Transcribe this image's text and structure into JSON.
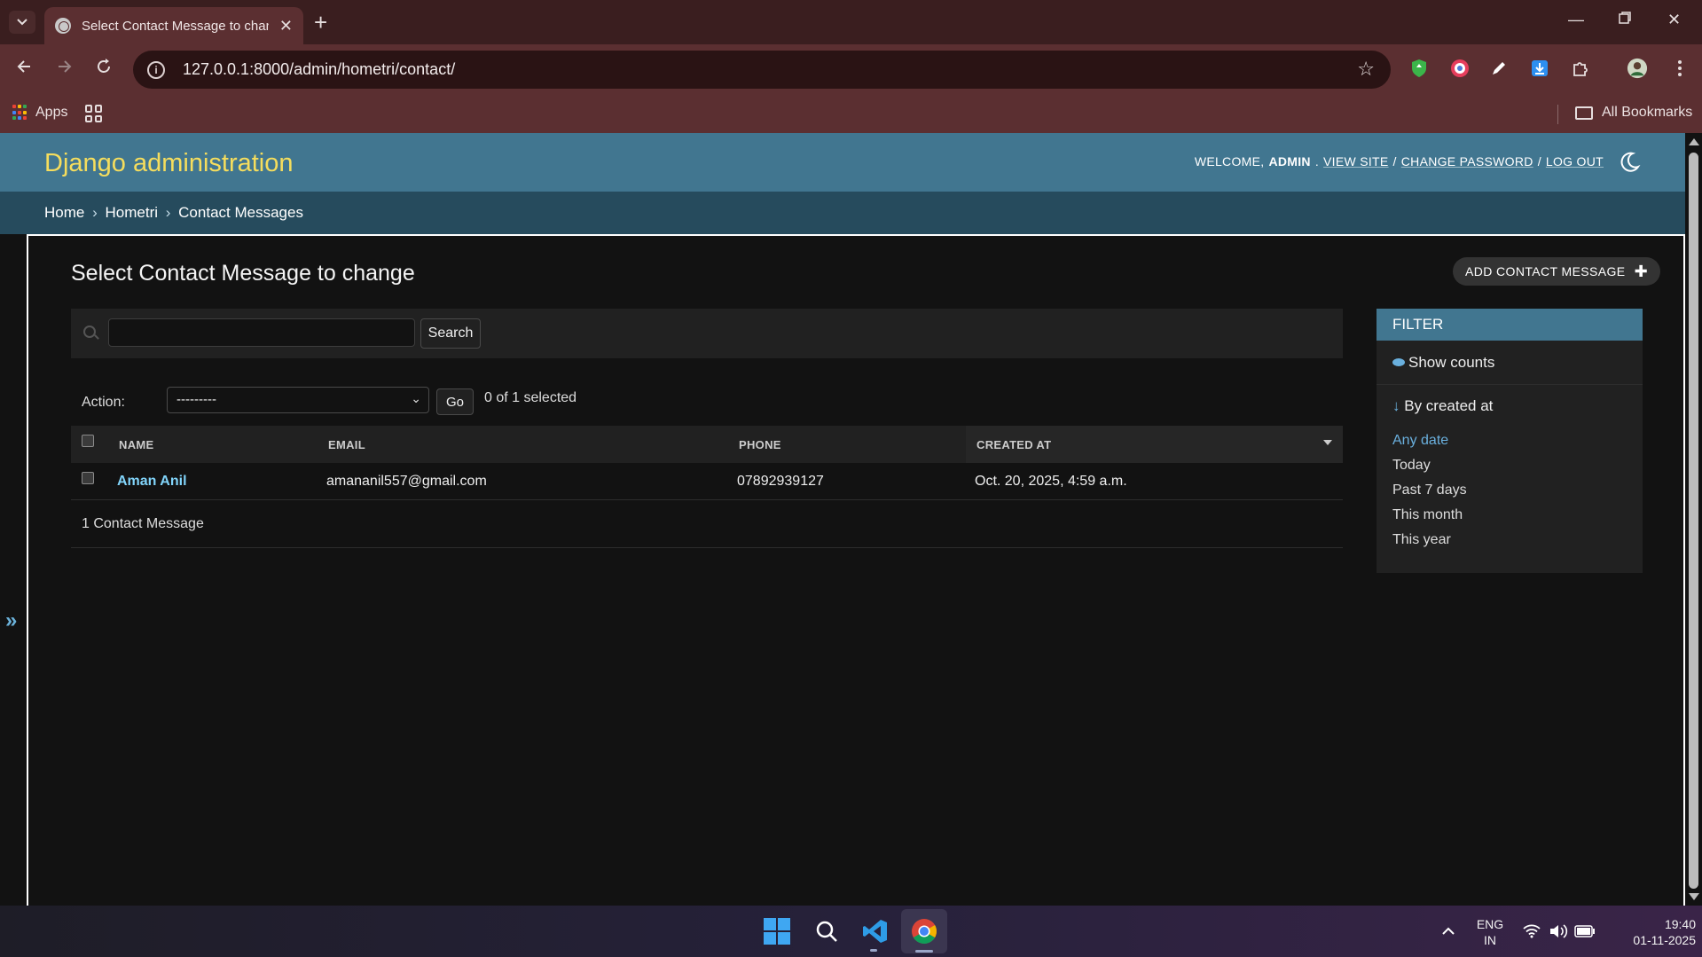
{
  "browser": {
    "tab_title": "Select Contact Message to change | Django site admin",
    "url": "127.0.0.1:8000/admin/hometri/contact/",
    "bookmarks_apps": "Apps",
    "bookmarks_all": "All Bookmarks"
  },
  "admin": {
    "brand": "Django administration",
    "welcome": "WELCOME,",
    "user": "ADMIN",
    "view_site": "VIEW SITE",
    "change_password": "CHANGE PASSWORD",
    "log_out": "LOG OUT",
    "separator": "/"
  },
  "breadcrumbs": [
    "Home",
    "Hometri",
    "Contact Messages"
  ],
  "breadcrumb_sep": "›",
  "page": {
    "title": "Select Contact Message to change",
    "add_button": "ADD CONTACT MESSAGE",
    "search_button": "Search",
    "action_label": "Action:",
    "action_value": "---------",
    "go_button": "Go",
    "selected_count": "0 of 1 selected",
    "sidebar_toggle": "»"
  },
  "table": {
    "columns": [
      "NAME",
      "EMAIL",
      "PHONE",
      "CREATED AT"
    ],
    "rows": [
      {
        "name": "Aman Anil",
        "email": "amananil557@gmail.com",
        "phone": "07892939127",
        "created_at": "Oct. 20, 2025, 4:59 a.m."
      }
    ],
    "count_text": "1 Contact Message"
  },
  "filter": {
    "title": "FILTER",
    "show_counts": "Show counts",
    "section_title": "By created at",
    "section_arrow": "↓",
    "options": [
      "Any date",
      "Today",
      "Past 7 days",
      "This month",
      "This year"
    ],
    "selected_option": "Any date"
  },
  "taskbar": {
    "lang_line1": "ENG",
    "lang_line2": "IN",
    "time": "19:40",
    "date": "01-11-2025"
  },
  "colors": {
    "header": "#417690",
    "breadcrumbs": "#264b5d",
    "brand": "#f5dd5d",
    "link": "#81d4fa",
    "background": "#121212"
  }
}
